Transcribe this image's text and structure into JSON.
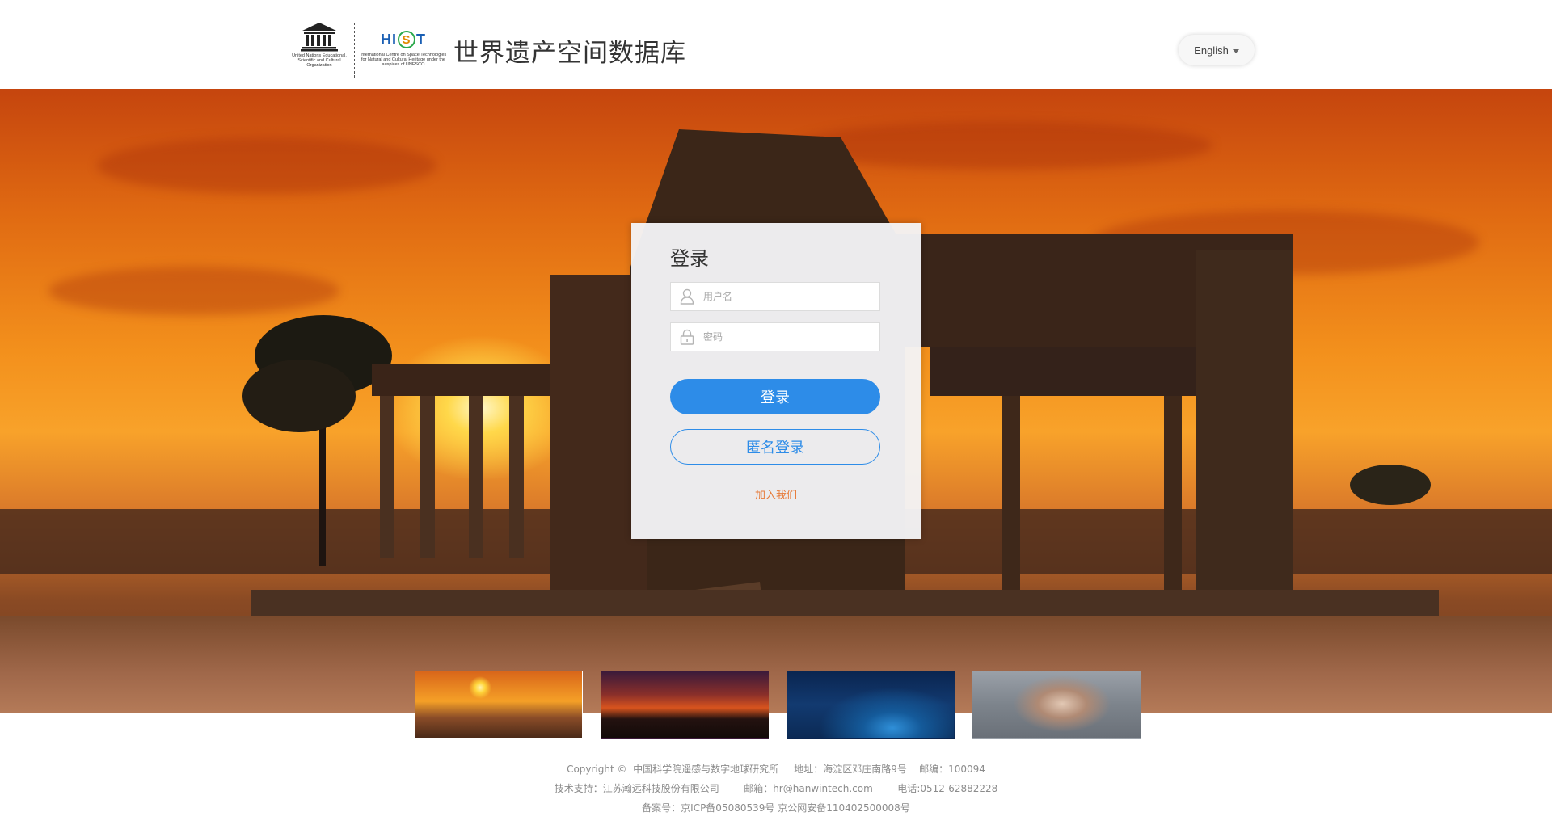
{
  "header": {
    "unesco_text": "United Nations Educational, Scientific and Cultural Organization",
    "hist_logo_text": "HIST",
    "hist_text": "International Centre on Space Technologies for Natural and Cultural Heritage under the auspices of UNESCO",
    "site_title": "世界遗产空间数据库",
    "language_label": "English"
  },
  "login": {
    "title": "登录",
    "username_placeholder": "用户名",
    "password_placeholder": "密码",
    "login_button": "登录",
    "anonymous_button": "匿名登录",
    "join_link": "加入我们"
  },
  "carousel": {
    "active_index": 0,
    "slide_count": 4
  },
  "footer": {
    "line1": "Copyright ©  中国科学院遥感与数字地球研究所     地址：海淀区邓庄南路9号    邮编：100094",
    "line2": "技术支持：江苏瀚远科技股份有限公司        邮箱：hr@hanwintech.com        电话:0512-62882228",
    "line3": "备案号：京ICP备05080539号 京公网安备110402500008号"
  },
  "colors": {
    "primary": "#2d8ce8",
    "link": "#e77b3a",
    "footer_text": "#8c8c8c"
  }
}
